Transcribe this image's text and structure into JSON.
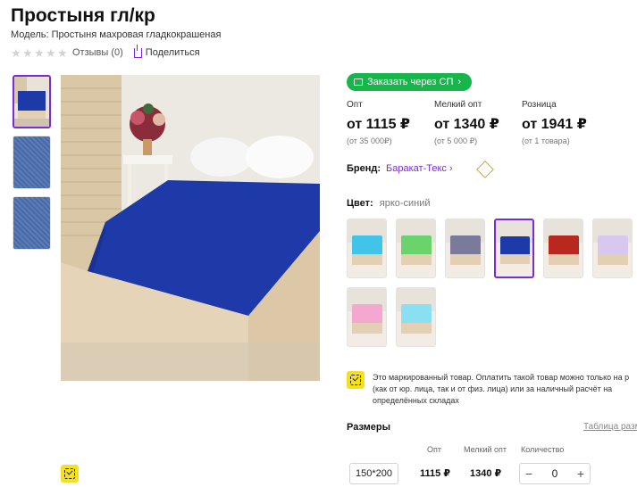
{
  "product": {
    "title": "Простыня гл/кр",
    "model": "Модель: Простыня махровая гладкокрашеная",
    "reviews": "Отзывы (0)",
    "share": "Поделиться"
  },
  "order_button": "Заказать через СП",
  "prices": [
    {
      "label": "Опт",
      "value": "от 1115 ₽",
      "note": "(от 35 000₽)"
    },
    {
      "label": "Мелкий опт",
      "value": "от 1340 ₽",
      "note": "(от 5 000 ₽)"
    },
    {
      "label": "Розница",
      "value": "от 1941 ₽",
      "note": "(от 1 товара)"
    }
  ],
  "brand": {
    "label": "Бренд:",
    "name": "Баракат-Текс"
  },
  "color": {
    "label": "Цвет:",
    "value": "ярко-синий"
  },
  "swatches": [
    "#40c4e8",
    "#6bd36b",
    "#7a7a9a",
    "#1e3aa8",
    "#b8281e",
    "#d8c8f0",
    "#f4a8d0",
    "#88e0f0"
  ],
  "notice": "Это маркированный товар. Оплатить такой товар можно только на р (как от юр. лица, так и от физ. лица) или за наличный расчёт на определённых складах",
  "sizes": {
    "title": "Размеры",
    "table_link": "Таблица разме",
    "headers": {
      "opt": "Опт",
      "small_opt": "Мелкий опт",
      "qty": "Количество"
    },
    "row": {
      "size": "150*200",
      "opt": "1115 ₽",
      "small_opt": "1340 ₽",
      "qty": "0"
    }
  },
  "colors": {
    "accent": "#7b2bd6",
    "green": "#17b64a",
    "badge": "#f5e021"
  }
}
